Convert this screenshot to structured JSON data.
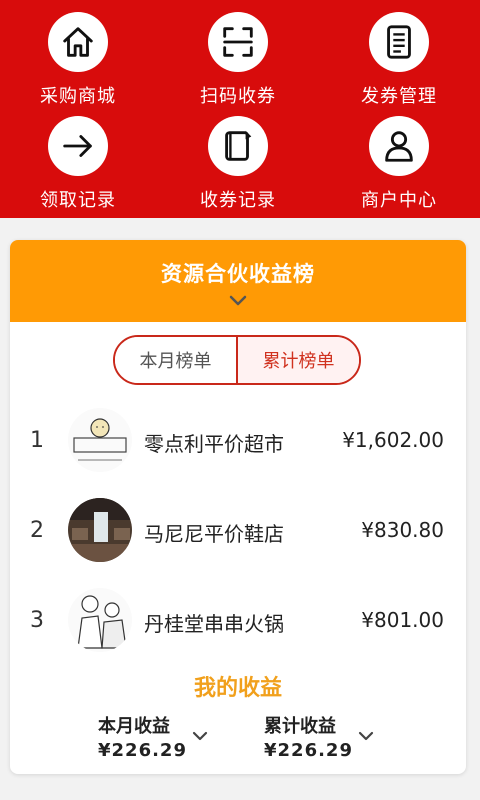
{
  "nav": [
    {
      "label": "采购商城",
      "icon": "house-icon"
    },
    {
      "label": "扫码收券",
      "icon": "scan-icon"
    },
    {
      "label": "发券管理",
      "icon": "document-icon"
    },
    {
      "label": "领取记录",
      "icon": "arrow-right-icon"
    },
    {
      "label": "收券记录",
      "icon": "notebook-icon"
    },
    {
      "label": "商户中心",
      "icon": "user-icon"
    }
  ],
  "ranking": {
    "title": "资源合伙收益榜",
    "tabs": [
      "本月榜单",
      "累计榜单"
    ],
    "active_tab": "累计榜单",
    "rows": [
      {
        "rank": "1",
        "name": "零点利平价超市",
        "amount": "¥1,602.00"
      },
      {
        "rank": "2",
        "name": "马尼尼平价鞋店",
        "amount": "¥830.80"
      },
      {
        "rank": "3",
        "name": "丹桂堂串串火锅",
        "amount": "¥801.00"
      }
    ]
  },
  "my_earnings": {
    "title": "我的收益",
    "monthly_label": "本月收益",
    "monthly_value": "¥226.29",
    "total_label": "累计收益",
    "total_value": "¥226.29"
  },
  "colors": {
    "header_red": "#d80c0c",
    "banner_orange": "#ff9a05",
    "accent_gold": "#f1a01c",
    "tab_border": "#c9281a"
  }
}
